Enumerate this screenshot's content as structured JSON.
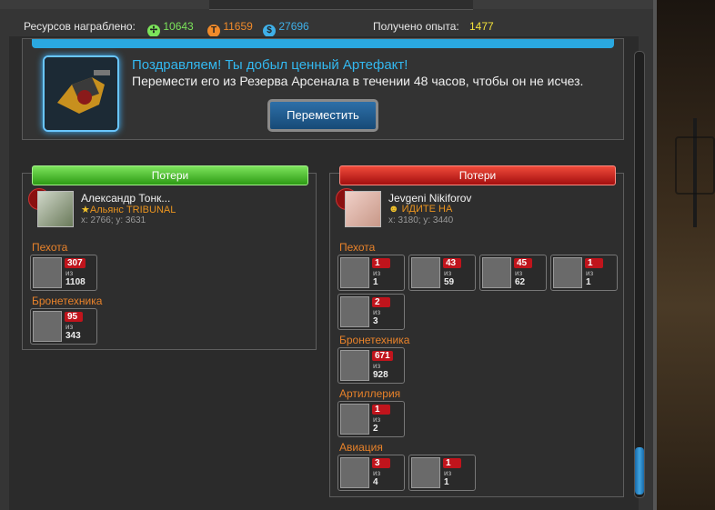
{
  "resources": {
    "label": "Ресурсов награблено:",
    "items": [
      {
        "icon": "green-resource-icon",
        "value": "10643",
        "color": "#7be35a"
      },
      {
        "icon": "orange-t-resource-icon",
        "glyph": "T",
        "value": "11659",
        "color": "#f08a2a"
      },
      {
        "icon": "blue-dollar-resource-icon",
        "glyph": "$",
        "value": "27696",
        "color": "#3fb0e8"
      }
    ],
    "exp_label": "Получено опыта:",
    "exp_value": "1477"
  },
  "artifact": {
    "title": "Поздравляем! Ты добыл ценный Артефакт!",
    "desc": "Перемести его из Резерва Арсенала в течении 48 часов, чтобы он не исчез.",
    "button": "Переместить"
  },
  "left": {
    "header": "Потери",
    "player": {
      "name": "Александр Тонк...",
      "alliance": "Альянс TRIBUNAL",
      "coords": "x: 2766; y: 3631"
    },
    "groups": [
      {
        "title": "Пехота",
        "units": [
          {
            "lost": "307",
            "of": "из",
            "total": "1108"
          }
        ]
      },
      {
        "title": "Бронетехника",
        "units": [
          {
            "lost": "95",
            "of": "из",
            "total": "343"
          }
        ]
      }
    ]
  },
  "right": {
    "header": "Потери",
    "player": {
      "name": "Jevgeni Nikiforov",
      "alliance": "ИДИТЕ НА",
      "coords": "x: 3180; y: 3440"
    },
    "groups": [
      {
        "title": "Пехота",
        "units": [
          {
            "lost": "1",
            "of": "из",
            "total": "1"
          },
          {
            "lost": "43",
            "of": "из",
            "total": "59"
          },
          {
            "lost": "45",
            "of": "из",
            "total": "62"
          },
          {
            "lost": "1",
            "of": "из",
            "total": "1"
          },
          {
            "lost": "2",
            "of": "из",
            "total": "3"
          }
        ]
      },
      {
        "title": "Бронетехника",
        "units": [
          {
            "lost": "671",
            "of": "из",
            "total": "928"
          }
        ]
      },
      {
        "title": "Артиллерия",
        "units": [
          {
            "lost": "1",
            "of": "из",
            "total": "2"
          }
        ]
      },
      {
        "title": "Авиация",
        "units": [
          {
            "lost": "3",
            "of": "из",
            "total": "4"
          },
          {
            "lost": "1",
            "of": "из",
            "total": "1"
          }
        ]
      }
    ]
  }
}
